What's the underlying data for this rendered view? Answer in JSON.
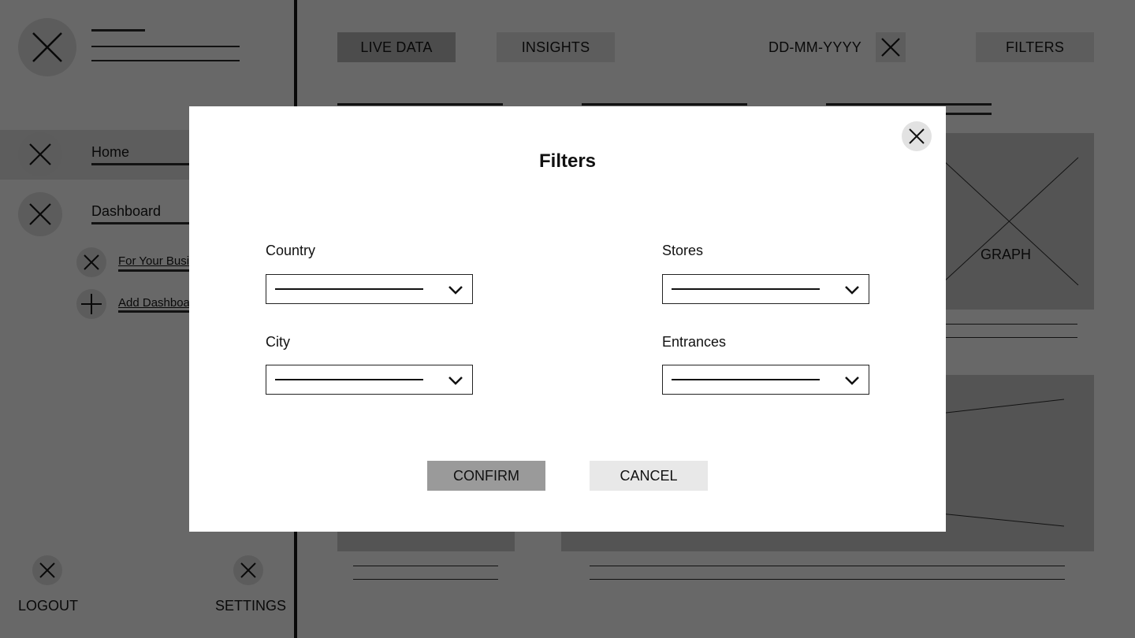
{
  "sidebar": {
    "nav": [
      {
        "label": "Home"
      },
      {
        "label": "Dashboard"
      }
    ],
    "sub": [
      {
        "label": "For Your Business"
      },
      {
        "label": "Add Dashboard"
      }
    ],
    "logout_label": "LOGOUT",
    "settings_label": "SETTINGS"
  },
  "topbar": {
    "tabs": [
      {
        "label": "LIVE DATA",
        "active": true
      },
      {
        "label": "INSIGHTS",
        "active": false
      }
    ],
    "date_placeholder": "DD-MM-YYYY",
    "filters_label": "FILTERS"
  },
  "content": {
    "graph_label": "GRAPH"
  },
  "modal": {
    "title": "Filters",
    "fields": [
      {
        "label": "Country"
      },
      {
        "label": "Stores"
      },
      {
        "label": "City"
      },
      {
        "label": "Entrances"
      }
    ],
    "confirm_label": "CONFIRM",
    "cancel_label": "CANCEL"
  },
  "colors": {
    "overlay": "#000000",
    "modal_bg": "#ffffff",
    "confirm_bg": "#9a9a9a",
    "cancel_bg": "#e8e8e8"
  }
}
